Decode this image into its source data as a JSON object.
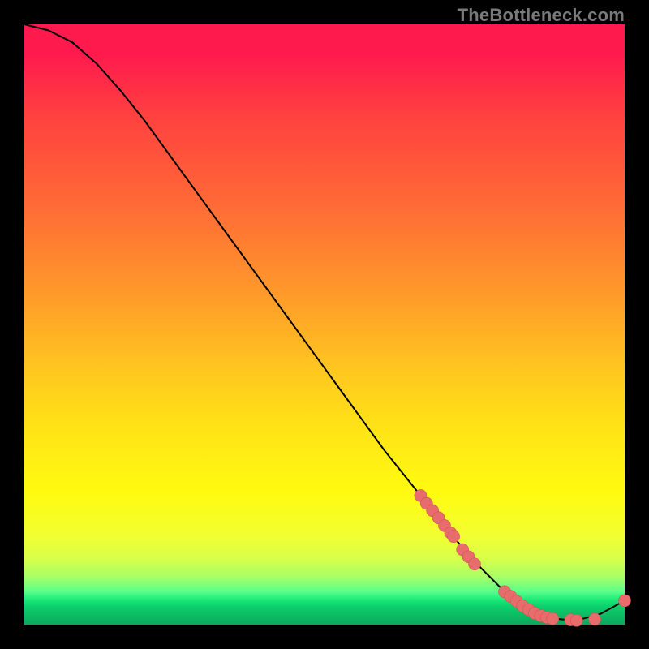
{
  "watermark": "TheBottleneck.com",
  "chart_data": {
    "type": "line",
    "title": "",
    "xlabel": "",
    "ylabel": "",
    "xlim": [
      0,
      100
    ],
    "ylim": [
      0,
      100
    ],
    "grid": false,
    "legend": false,
    "annotations": [],
    "series": [
      {
        "name": "curve",
        "x": [
          0,
          4,
          8,
          12,
          16,
          20,
          24,
          28,
          32,
          36,
          40,
          44,
          48,
          52,
          56,
          60,
          64,
          68,
          72,
          76,
          80,
          84,
          88,
          92,
          96,
          100
        ],
        "values": [
          100,
          99,
          97,
          93.5,
          89,
          84,
          78.5,
          73,
          67.5,
          62,
          56.5,
          51,
          45.5,
          40,
          34.5,
          29,
          24,
          19,
          14,
          9.5,
          5.5,
          2.5,
          1,
          0.7,
          1.8,
          4
        ]
      }
    ],
    "points": {
      "name": "markers",
      "x": [
        66,
        67,
        68,
        69,
        70,
        71,
        71.5,
        73,
        74,
        75,
        80,
        81,
        82,
        83,
        84,
        85,
        86,
        87,
        88,
        91,
        92,
        95,
        100
      ],
      "values": [
        21.5,
        20.2,
        19,
        17.8,
        16.5,
        15.3,
        14.7,
        12.5,
        11.3,
        10.1,
        5.5,
        4.7,
        3.9,
        3.1,
        2.5,
        1.9,
        1.5,
        1.2,
        1.0,
        0.8,
        0.7,
        0.9,
        4.0
      ]
    },
    "colors": {
      "curve": "#000000",
      "markers": "#e86c6c",
      "gradient_top": "#ff1a4d",
      "gradient_mid": "#ffe516",
      "gradient_bottom": "#0aa85c"
    }
  }
}
